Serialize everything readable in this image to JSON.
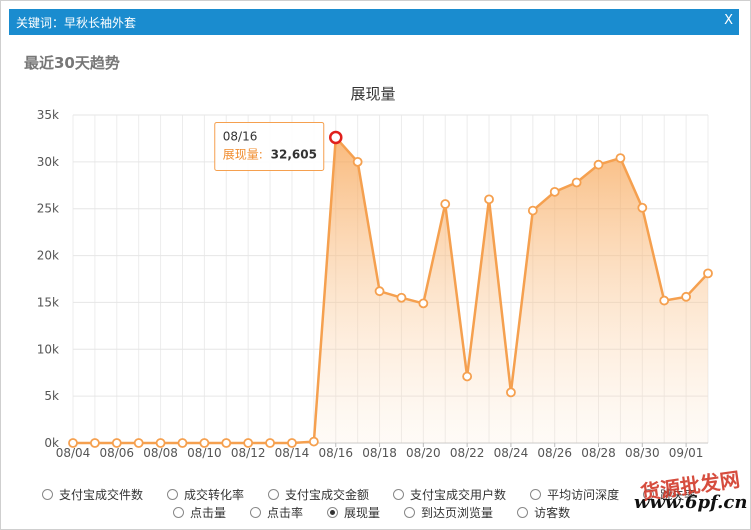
{
  "dialog": {
    "title": "关键词：早秋长袖外套",
    "close_label": "X"
  },
  "section_title": "最近30天趋势",
  "chart_data": {
    "type": "line",
    "title": "展现量",
    "series": [
      {
        "name": "展现量",
        "color": "#f5a04f",
        "x": [
          "08/04",
          "08/05",
          "08/06",
          "08/07",
          "08/08",
          "08/09",
          "08/10",
          "08/11",
          "08/12",
          "08/13",
          "08/14",
          "08/15",
          "08/16",
          "08/17",
          "08/18",
          "08/19",
          "08/20",
          "08/21",
          "08/22",
          "08/23",
          "08/24",
          "08/25",
          "08/26",
          "08/27",
          "08/28",
          "08/29",
          "08/30",
          "08/31",
          "09/01",
          "09/02"
        ],
        "values": [
          0,
          0,
          0,
          0,
          0,
          0,
          0,
          0,
          0,
          0,
          0,
          150,
          32605,
          30000,
          16200,
          15500,
          14900,
          25500,
          7100,
          26000,
          5400,
          24800,
          26800,
          27800,
          29700,
          30400,
          25100,
          15200,
          15600,
          18100
        ]
      }
    ],
    "x_tick_labels": [
      "08/04",
      "08/06",
      "08/08",
      "08/10",
      "08/12",
      "08/14",
      "08/16",
      "08/18",
      "08/20",
      "08/22",
      "08/24",
      "08/26",
      "08/28",
      "08/30",
      "09/01"
    ],
    "y_ticks": [
      0,
      5000,
      10000,
      15000,
      20000,
      25000,
      30000,
      35000
    ],
    "y_tick_labels": [
      "0k",
      "5k",
      "10k",
      "15k",
      "20k",
      "25k",
      "30k",
      "35k"
    ],
    "ylim": [
      0,
      35000
    ],
    "grid": true,
    "legend_position": "bottom",
    "tooltip": {
      "date": "08/16",
      "label": "展现量:",
      "value": "32,605"
    },
    "highlight_index": 12
  },
  "metric_selector": {
    "row1": [
      {
        "label": "支付宝成交件数",
        "checked": false
      },
      {
        "label": "成交转化率",
        "checked": false
      },
      {
        "label": "支付宝成交金额",
        "checked": false
      },
      {
        "label": "支付宝成交用户数",
        "checked": false
      },
      {
        "label": "平均访问深度",
        "checked": false
      },
      {
        "label": "跳失率",
        "checked": false
      }
    ],
    "row2": [
      {
        "label": "点击量",
        "checked": false
      },
      {
        "label": "点击率",
        "checked": false
      },
      {
        "label": "展现量",
        "checked": true
      },
      {
        "label": "到达页浏览量",
        "checked": false
      },
      {
        "label": "访客数",
        "checked": false
      }
    ]
  },
  "watermark": {
    "text_cn": "货源批发网",
    "url": "www.6pf.cn"
  }
}
